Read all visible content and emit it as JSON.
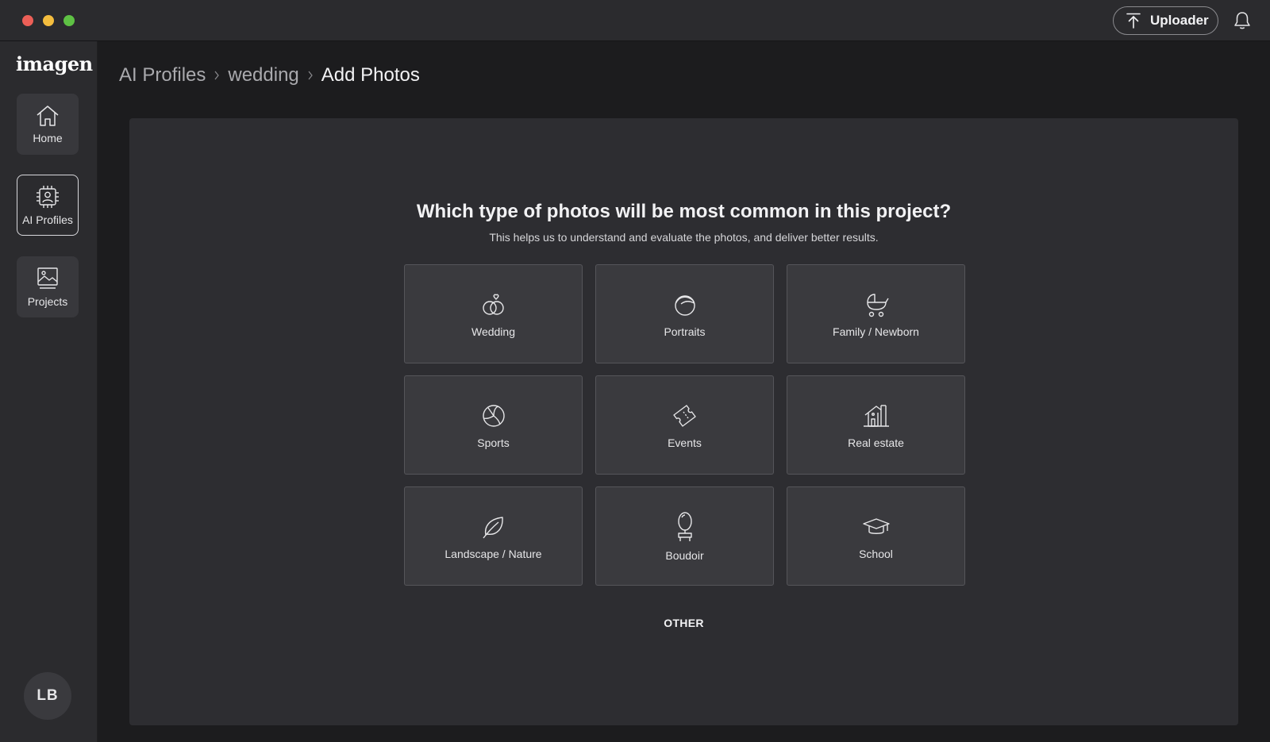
{
  "titlebar": {
    "uploader_label": "Uploader"
  },
  "sidebar": {
    "logo": "imagen",
    "items": [
      {
        "label": "Home",
        "icon": "home-icon"
      },
      {
        "label": "AI Profiles",
        "icon": "ai-profile-icon",
        "active": true
      },
      {
        "label": "Projects",
        "icon": "projects-icon"
      }
    ],
    "avatar_initials": "LB"
  },
  "breadcrumb": {
    "items": [
      "AI Profiles",
      "wedding",
      "Add Photos"
    ]
  },
  "main": {
    "question": "Which type of photos will be most common in this project?",
    "subtitle": "This helps us to understand and evaluate the photos, and deliver better results.",
    "categories": [
      {
        "label": "Wedding",
        "icon": "rings-icon"
      },
      {
        "label": "Portraits",
        "icon": "face-icon"
      },
      {
        "label": "Family / Newborn",
        "icon": "baby-stroller-icon"
      },
      {
        "label": "Sports",
        "icon": "volleyball-icon"
      },
      {
        "label": "Events",
        "icon": "ticket-icon"
      },
      {
        "label": "Real estate",
        "icon": "house-icon"
      },
      {
        "label": "Landscape / Nature",
        "icon": "leaf-icon"
      },
      {
        "label": "Boudoir",
        "icon": "mirror-icon"
      },
      {
        "label": "School",
        "icon": "graduation-cap-icon"
      }
    ],
    "other_label": "OTHER"
  },
  "colors": {
    "background": "#1c1c1e",
    "sidebar": "#2b2b2e",
    "panel": "#2d2d31",
    "card": "#3a3a3e",
    "text": "#e8e8ea"
  }
}
